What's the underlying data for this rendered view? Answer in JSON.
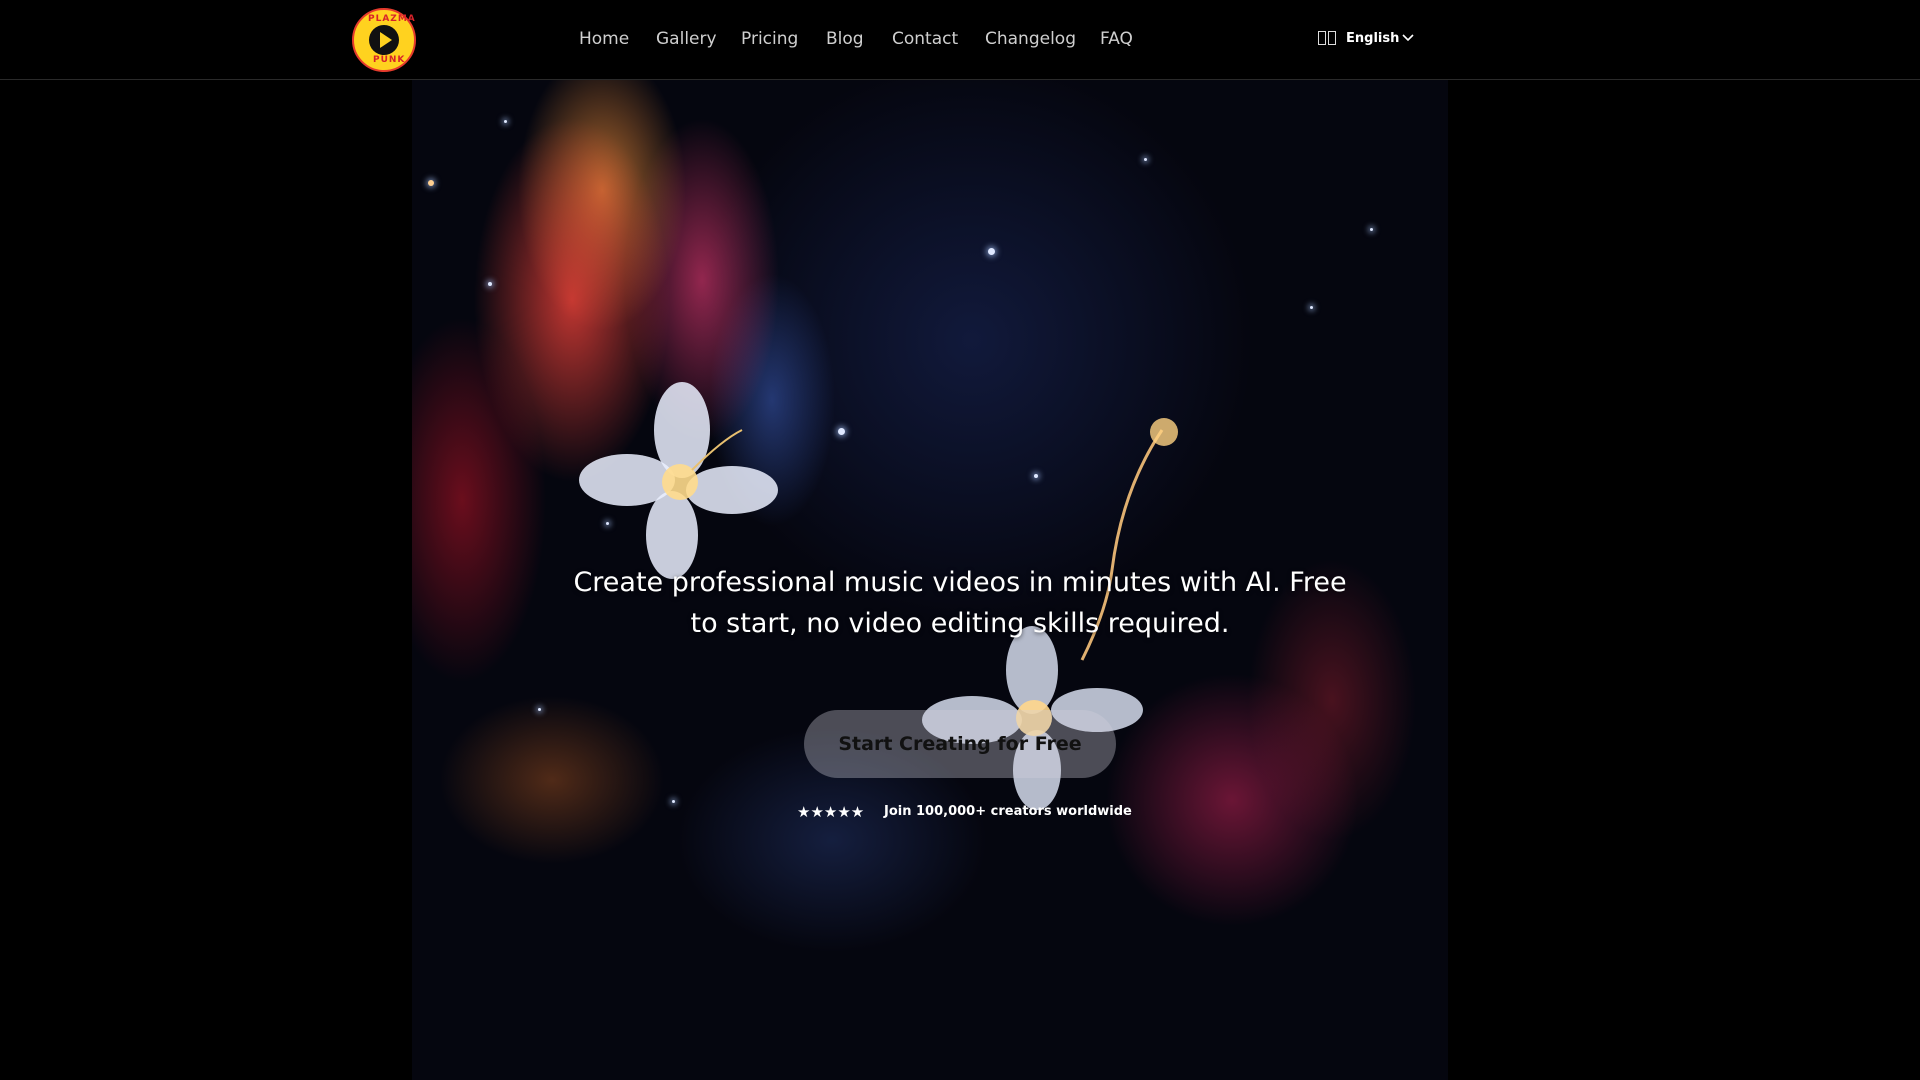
{
  "brand": {
    "logo_text_top": "PLAZMA",
    "logo_text_bottom": "PUNK",
    "logo_colors": {
      "fill": "#ffd21f",
      "ring": "#e53b2c",
      "play": "#111111"
    }
  },
  "nav": {
    "items": [
      {
        "label": "Home"
      },
      {
        "label": "Gallery"
      },
      {
        "label": "Pricing"
      },
      {
        "label": "Blog"
      },
      {
        "label": "Contact"
      },
      {
        "label": "Changelog"
      },
      {
        "label": "FAQ"
      }
    ]
  },
  "language": {
    "selected": "English",
    "icon": "language-icon"
  },
  "hero": {
    "headline": "Create professional music videos in minutes with AI. Free to start, no video editing skills required.",
    "cta_label": "Start Creating for Free",
    "rating_stars": "★★★★★",
    "rating_text": "Join 100,000+ creators worldwide"
  }
}
